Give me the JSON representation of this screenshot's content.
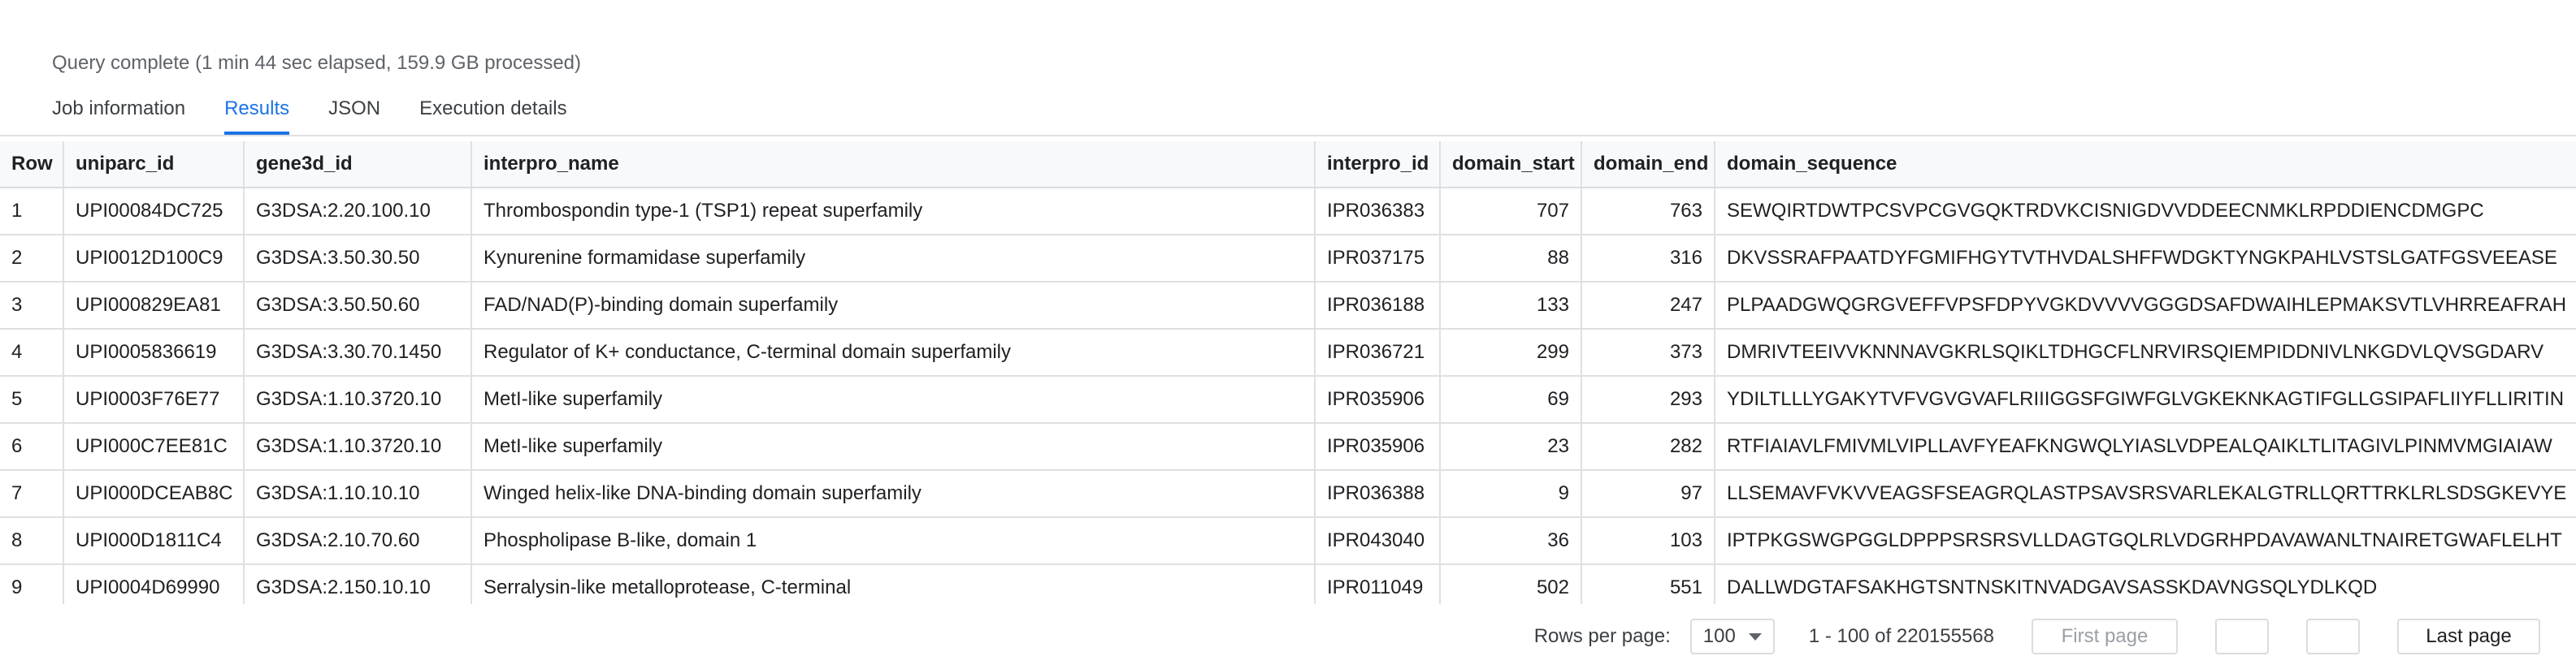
{
  "status": "Query complete (1 min 44 sec elapsed, 159.9 GB processed)",
  "tabs": [
    "Job information",
    "Results",
    "JSON",
    "Execution details"
  ],
  "active_tab": "Results",
  "columns": [
    "Row",
    "uniparc_id",
    "gene3d_id",
    "interpro_name",
    "interpro_id",
    "domain_start",
    "domain_end",
    "domain_sequence"
  ],
  "rows": [
    [
      "1",
      "UPI00084DC725",
      "G3DSA:2.20.100.10",
      "Thrombospondin type-1 (TSP1) repeat superfamily",
      "IPR036383",
      "707",
      "763",
      "SEWQIRTDWTPCSVPCGVGQKTRDVKCISNIGDVVDDEECNMKLRPDDIENCDMGPC"
    ],
    [
      "2",
      "UPI0012D100C9",
      "G3DSA:3.50.30.50",
      "Kynurenine formamidase superfamily",
      "IPR037175",
      "88",
      "316",
      "DKVSSRAFPAATDYFGMIFHGYTVTHVDALSHFFWDGKTYNGKPAHLVSTSLGATFGSVEEASE"
    ],
    [
      "3",
      "UPI000829EA81",
      "G3DSA:3.50.50.60",
      "FAD/NAD(P)-binding domain superfamily",
      "IPR036188",
      "133",
      "247",
      "PLPAADGWQGRGVEFFVPSFDPYVGKDVVVVGGGDSAFDWAIHLEPMAKSVTLVHRREAFRAH"
    ],
    [
      "4",
      "UPI0005836619",
      "G3DSA:3.30.70.1450",
      "Regulator of K+ conductance, C-terminal domain superfamily",
      "IPR036721",
      "299",
      "373",
      "DMRIVTEEIVVKNNNAVGKRLSQIKLTDHGCFLNRVIRSQIEMPIDDNIVLNKGDVLQVSGDARV"
    ],
    [
      "5",
      "UPI0003F76E77",
      "G3DSA:1.10.3720.10",
      "MetI-like superfamily",
      "IPR035906",
      "69",
      "293",
      "YDILTLLLYGAKYTVFVGVGVAFLRIIIGGSFGIWFGLVGKEKNKAGTIFGLLGSIPAFLIIYFLLIRITIN"
    ],
    [
      "6",
      "UPI000C7EE81C",
      "G3DSA:1.10.3720.10",
      "MetI-like superfamily",
      "IPR035906",
      "23",
      "282",
      "RTFIAIAVLFMIVMLVIPLLAVFYEAFKNGWQLYIASLVDPEALQAIKLTLITAGIVLPINMVMGIAIAW"
    ],
    [
      "7",
      "UPI000DCEAB8C",
      "G3DSA:1.10.10.10",
      "Winged helix-like DNA-binding domain superfamily",
      "IPR036388",
      "9",
      "97",
      "LLSEMAVFVKVVEAGSFSEAGRQLASTPSAVSRSVARLEKALGTRLLQRTTRKLRLSDSGKEVYE"
    ],
    [
      "8",
      "UPI000D1811C4",
      "G3DSA:2.10.70.60",
      "Phospholipase B-like, domain 1",
      "IPR043040",
      "36",
      "103",
      "IPTPKGSWGPGGLDPPPSRSRSVLLDAGTGQLRLVDGRHPDAVAWANLTNAIRETGWAFLELHT"
    ],
    [
      "9",
      "UPI0004D69990",
      "G3DSA:2.150.10.10",
      "Serralysin-like metalloprotease, C-terminal",
      "IPR011049",
      "502",
      "551",
      "DALLWDGTAFSAKHGTSNTNSKITNVADGAVSASSKDAVNGSQLYDLKQD"
    ]
  ],
  "footer": {
    "rows_per_page_label": "Rows per page:",
    "rows_per_page_value": "100",
    "range": "1 - 100 of 220155568",
    "first_page": "First page",
    "last_page": "Last page"
  }
}
